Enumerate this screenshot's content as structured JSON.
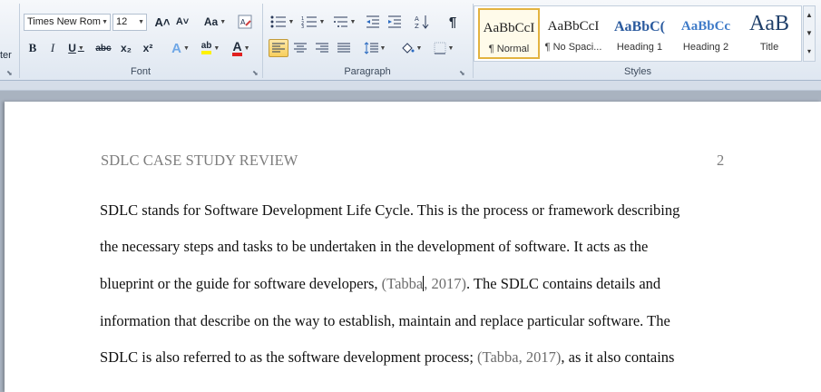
{
  "ribbon": {
    "left_cut_label": "ter",
    "font": {
      "group_label": "Font",
      "font_name": "Times New Rom",
      "font_size": "12",
      "grow_icon": "A˄",
      "shrink_icon": "A˅",
      "change_case": "Aa",
      "bold": "B",
      "italic": "I",
      "underline": "U",
      "strike": "abc",
      "subscript": "x₂",
      "superscript": "x²",
      "effects": "A",
      "highlight": "ab",
      "font_color": "A"
    },
    "paragraph": {
      "group_label": "Paragraph",
      "pilcrow": "¶"
    },
    "styles": {
      "group_label": "Styles",
      "items": [
        {
          "sample": "AaBbCcI",
          "name": "¶ Normal"
        },
        {
          "sample": "AaBbCcI",
          "name": "¶ No Spaci..."
        },
        {
          "sample": "AaBbC(",
          "name": "Heading 1"
        },
        {
          "sample": "AaBbCc",
          "name": "Heading 2"
        },
        {
          "sample": "AaB",
          "name": "Title"
        }
      ]
    }
  },
  "document": {
    "header_title": "SDLC CASE STUDY REVIEW",
    "page_number": "2",
    "lines": [
      "SDLC stands for Software Development Life Cycle. This is the process or framework describing",
      "the necessary steps and tasks to be undertaken in the development of software. It acts as the",
      {
        "before": "blueprint or the guide for software developers, ",
        "cite_a": "(Tabba",
        "cite_b": ", 2017)",
        "after": ". The SDLC contains details and"
      },
      "information that describe on the way to establish, maintain and replace particular software. The",
      {
        "before": "SDLC is also referred to as the software development process; ",
        "cite": "(Tabba, 2017)",
        "after": ", as it also contains"
      }
    ]
  },
  "colors": {
    "accent_active": "#f8cf5d",
    "heading_blue": "#2a5a9e",
    "font_color_red": "#e02020",
    "highlight_yellow": "#fff200"
  }
}
